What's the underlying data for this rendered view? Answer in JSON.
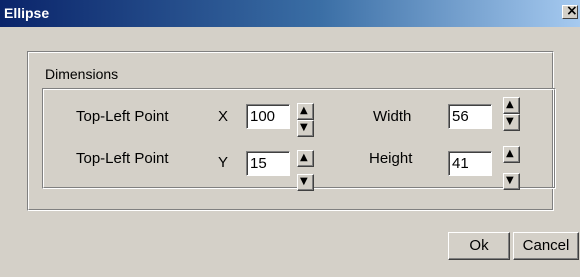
{
  "window": {
    "title": "Ellipse",
    "close_glyph": "×"
  },
  "dimensions": {
    "group_label": "Dimensions",
    "rows": [
      {
        "label": "Top-Left Point",
        "axis": "X",
        "value": "100",
        "size_label": "Width",
        "size_value": "56"
      },
      {
        "label": "Top-Left Point",
        "axis": "Y",
        "value": "15",
        "size_label": "Height",
        "size_value": "41"
      }
    ]
  },
  "buttons": {
    "ok": "Ok",
    "cancel": "Cancel"
  },
  "icons": {
    "spin_up": "▲",
    "spin_down": "▼"
  }
}
